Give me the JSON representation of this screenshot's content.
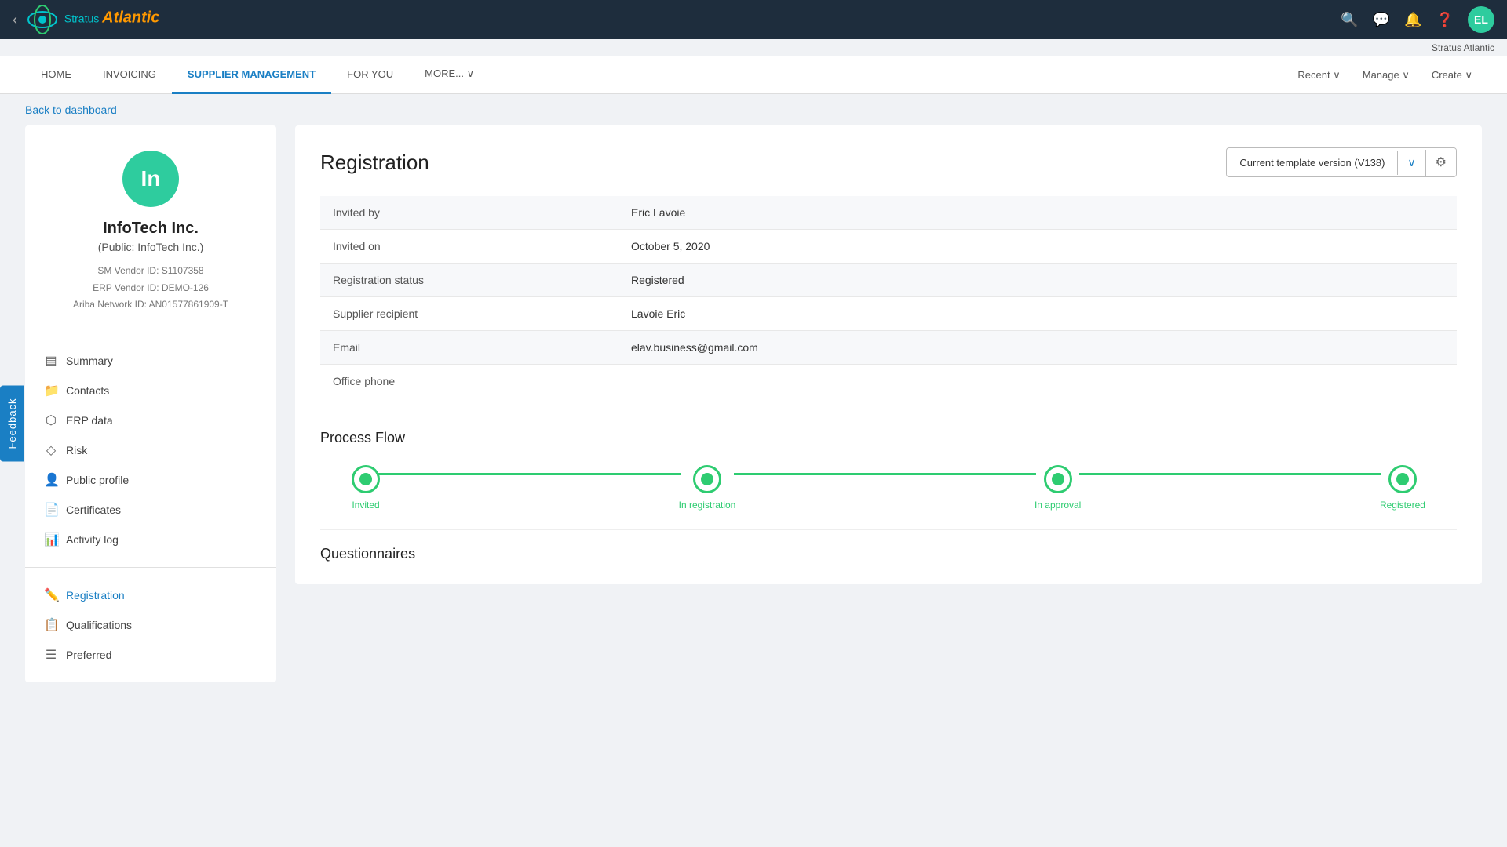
{
  "topbar": {
    "back_label": "‹",
    "logo_stratus": "Stratus",
    "logo_atlantic": "Atlantic",
    "icons": [
      "search",
      "chat",
      "bell",
      "help"
    ],
    "avatar_initials": "EL",
    "username": "Stratus Atlantic"
  },
  "navbar": {
    "items": [
      {
        "label": "HOME",
        "active": false
      },
      {
        "label": "INVOICING",
        "active": false
      },
      {
        "label": "SUPPLIER MANAGEMENT",
        "active": true
      },
      {
        "label": "FOR YOU",
        "active": false
      },
      {
        "label": "MORE... ∨",
        "active": false
      }
    ],
    "right_items": [
      {
        "label": "Recent ∨"
      },
      {
        "label": "Manage ∨"
      },
      {
        "label": "Create ∨"
      }
    ]
  },
  "breadcrumb": {
    "link_label": "Back to dashboard"
  },
  "vendor": {
    "avatar_initials": "In",
    "name": "InfoTech Inc.",
    "public_name": "(Public: InfoTech Inc.)",
    "sm_vendor_id": "SM Vendor ID:  S1107358",
    "erp_vendor_id": "ERP Vendor ID:  DEMO-126",
    "ariba_network_id": "Ariba Network ID:  AN01577861909-T"
  },
  "left_menu": {
    "section1": [
      {
        "label": "Summary",
        "icon": "📋",
        "active": false
      },
      {
        "label": "Contacts",
        "icon": "📁",
        "active": false
      },
      {
        "label": "ERP data",
        "icon": "⬡",
        "active": false
      },
      {
        "label": "Risk",
        "icon": "◇",
        "active": false
      },
      {
        "label": "Public profile",
        "icon": "👤",
        "active": false
      },
      {
        "label": "Certificates",
        "icon": "📄",
        "active": false
      },
      {
        "label": "Activity log",
        "icon": "📊",
        "active": false
      }
    ],
    "section2": [
      {
        "label": "Registration",
        "icon": "✏️",
        "active": true
      },
      {
        "label": "Qualifications",
        "icon": "📋",
        "active": false
      },
      {
        "label": "Preferred",
        "icon": "☰",
        "active": false
      }
    ]
  },
  "registration": {
    "title": "Registration",
    "template": {
      "label": "Current template version (V138)",
      "chevron": "∨",
      "gear": "⚙"
    },
    "fields": [
      {
        "label": "Invited by",
        "value": "Eric Lavoie"
      },
      {
        "label": "Invited on",
        "value": "October 5, 2020"
      },
      {
        "label": "Registration status",
        "value": "Registered"
      },
      {
        "label": "Supplier recipient",
        "value": "Lavoie Eric"
      },
      {
        "label": "Email",
        "value": "elav.business@gmail.com"
      },
      {
        "label": "Office phone",
        "value": ""
      }
    ],
    "process_flow": {
      "title": "Process Flow",
      "steps": [
        {
          "label": "Invited"
        },
        {
          "label": "In registration"
        },
        {
          "label": "In approval"
        },
        {
          "label": "Registered"
        }
      ]
    },
    "questionnaires_title": "Questionnaires"
  },
  "feedback": {
    "label": "Feedback"
  }
}
